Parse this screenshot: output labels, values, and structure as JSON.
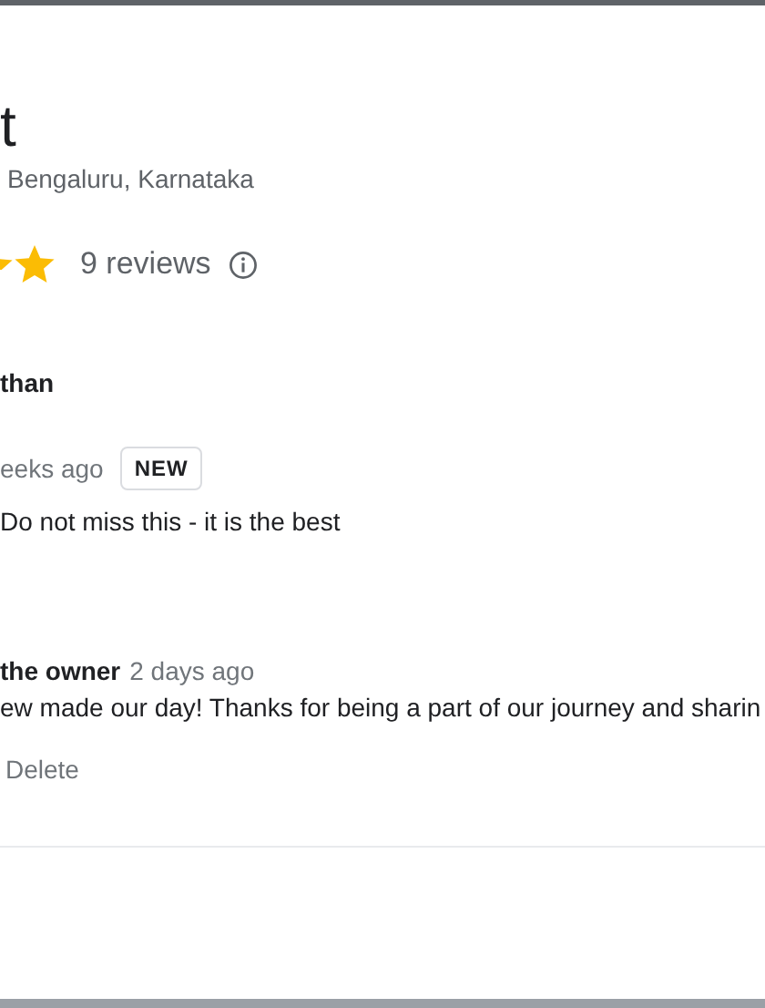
{
  "place": {
    "title": "t",
    "address": "Bengaluru, Karnataka",
    "review_count": "9 reviews"
  },
  "review": {
    "author": "than",
    "time": "eeks ago",
    "badge": "NEW",
    "text": "Do not miss this - it is the best"
  },
  "owner_reply": {
    "author": "the owner",
    "time": "2 days ago",
    "text": "ew made our day! Thanks for being a part of our journey and sharin",
    "action": "Delete"
  }
}
